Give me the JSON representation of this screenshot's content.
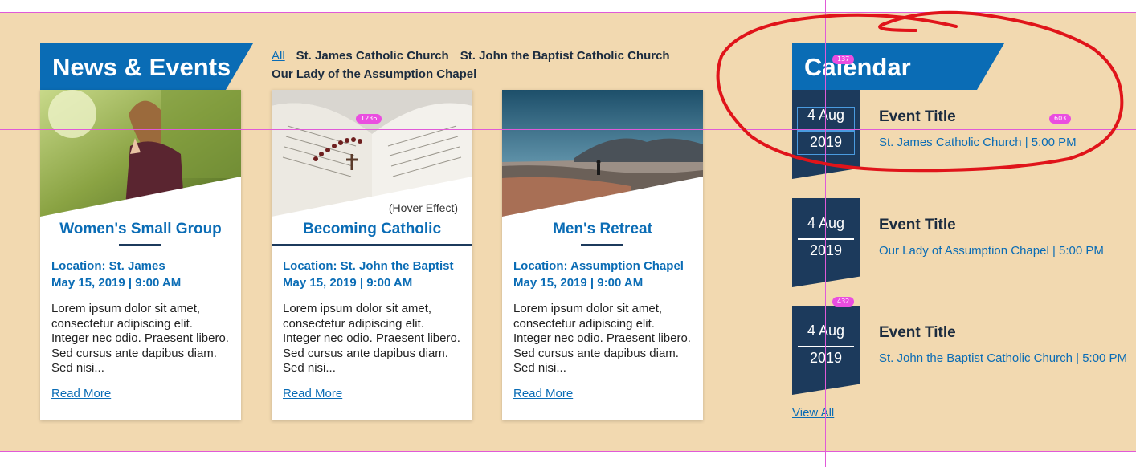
{
  "news": {
    "heading": "News & Events",
    "filters": {
      "all": "All",
      "items": [
        "St. James Catholic Church",
        "St. John the Baptist Catholic Church",
        "Our Lady of the Assumption Chapel"
      ]
    },
    "cards": [
      {
        "title": "Women's Small Group",
        "location": "Location: St. James",
        "datetime": "May 15, 2019 | 9:00 AM",
        "excerpt": "Lorem ipsum dolor sit amet, consectetur adipiscing elit. Integer nec odio. Praesent libero. Sed cursus ante dapibus diam. Sed nisi...",
        "link": "Read More"
      },
      {
        "title": "Becoming Catholic",
        "hover_note": "(Hover Effect)",
        "location": "Location: St. John the Baptist",
        "datetime": "May 15, 2019 | 9:00 AM",
        "excerpt": "Lorem ipsum dolor sit amet, consectetur adipiscing elit. Integer nec odio. Praesent libero. Sed cursus ante dapibus diam. Sed nisi...",
        "link": "Read More"
      },
      {
        "title": "Men's Retreat",
        "location": "Location: Assumption Chapel",
        "datetime": "May 15, 2019 | 9:00 AM",
        "excerpt": "Lorem ipsum dolor sit amet, consectetur adipiscing elit. Integer nec odio. Praesent libero. Sed cursus ante dapibus diam. Sed nisi...",
        "link": "Read More"
      }
    ]
  },
  "calendar": {
    "heading": "Calendar",
    "events": [
      {
        "day": "4 Aug",
        "year": "2019",
        "title": "Event Title",
        "subtitle": "St. James Catholic Church | 5:00 PM"
      },
      {
        "day": "4 Aug",
        "year": "2019",
        "title": "Event Title",
        "subtitle": "Our Lady of Assumption Chapel | 5:00 PM"
      },
      {
        "day": "4 Aug",
        "year": "2019",
        "title": "Event Title",
        "subtitle": "St. John the Baptist Catholic Church | 5:00 PM"
      }
    ],
    "view_all": "View All"
  },
  "measurements": {
    "badge_a": "137",
    "badge_b": "1236",
    "badge_c": "603",
    "badge_d": "432"
  },
  "colors": {
    "band": "#f2d9b0",
    "accent_blue": "#0a6cb5",
    "navy": "#1c3a5c",
    "guide": "#e05ad8",
    "annotation_red": "#e0141a"
  }
}
